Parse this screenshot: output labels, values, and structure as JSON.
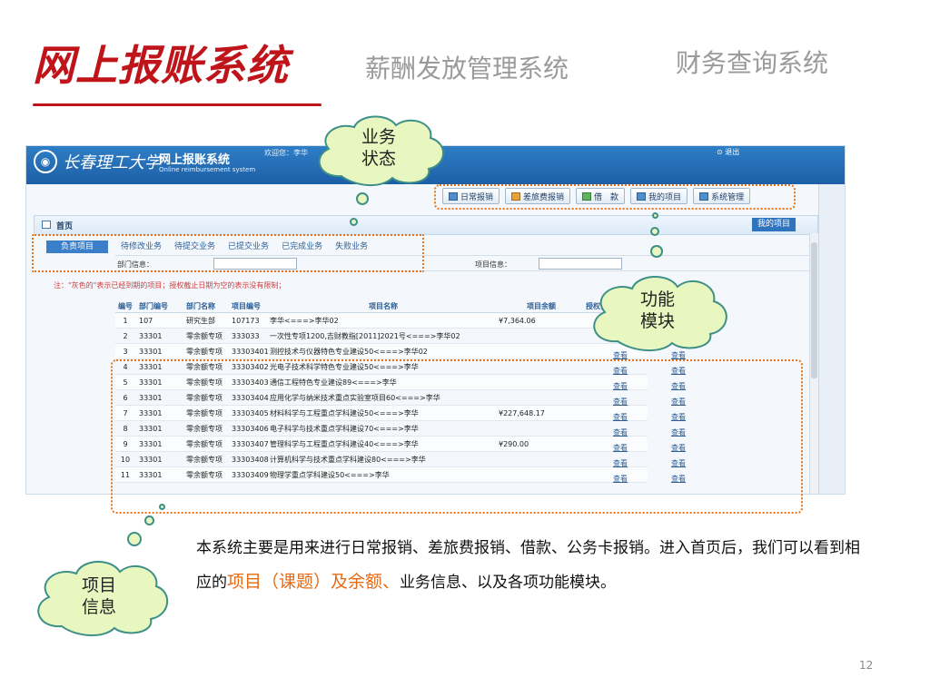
{
  "slide": {
    "title": "网上报账系统",
    "subtitle_1": "薪酬发放管理系统",
    "subtitle_2": "财务查询系统",
    "page_number": "12"
  },
  "app": {
    "university": "长春理工大学",
    "system_name": "网上报账系统",
    "system_name_en": "Online reimbursement system",
    "welcome": "欢迎您：李华",
    "exit": "退出",
    "toolbar": [
      {
        "label": "日常报销",
        "icon": "document-icon"
      },
      {
        "label": "差旅费报销",
        "icon": "car-icon"
      },
      {
        "label": "借　款",
        "icon": "money-icon"
      },
      {
        "label": "我的项目",
        "icon": "list-icon"
      },
      {
        "label": "系统管理",
        "icon": "gear-icon"
      }
    ],
    "home": "首页",
    "my_projects": "我的项目",
    "tabs": [
      "负责项目",
      "待修改业务",
      "待提交业务",
      "已提交业务",
      "已完成业务",
      "失败业务"
    ],
    "active_tab": "负责项目",
    "filter": {
      "dept_label": "部门信息：",
      "project_label": "项目信息："
    },
    "note": "注：\"灰色的\"表示已经到期的项目；授权截止日期为空的表示没有限制；",
    "table": {
      "headers": [
        "编号",
        "部门编号",
        "部门名称",
        "项目编号",
        "项目名称",
        "项目余额",
        "授权使用"
      ],
      "rows": [
        [
          "1",
          "107",
          "研究生部",
          "107173",
          "李华<===>李华02",
          "¥7,364.06",
          ""
        ],
        [
          "2",
          "33301",
          "零余额专项",
          "333033",
          "一次性专项1200,吉财教指[2011]2021号<===>李华02",
          "",
          ""
        ],
        [
          "3",
          "33301",
          "零余额专项",
          "33303401",
          "测控技术与仪器特色专业建设50<===>李华02",
          "",
          ""
        ],
        [
          "4",
          "33301",
          "零余额专项",
          "33303402",
          "光电子技术科学特色专业建设50<===>李华",
          "",
          ""
        ],
        [
          "5",
          "33301",
          "零余额专项",
          "33303403",
          "通信工程特色专业建设89<===>李华",
          "",
          ""
        ],
        [
          "6",
          "33301",
          "零余额专项",
          "33303404",
          "应用化学与纳米技术重点实验室项目60<===>李华",
          "",
          ""
        ],
        [
          "7",
          "33301",
          "零余额专项",
          "33303405",
          "材料科学与工程重点学科建设50<===>李华",
          "¥227,648.17",
          ""
        ],
        [
          "8",
          "33301",
          "零余额专项",
          "33303406",
          "电子科学与技术重点学科建设70<===>李华",
          "",
          ""
        ],
        [
          "9",
          "33301",
          "零余额专项",
          "33303407",
          "管理科学与工程重点学科建设40<===>李华",
          "¥290.00",
          ""
        ],
        [
          "10",
          "33301",
          "零余额专项",
          "33303408",
          "计算机科学与技术重点学科建设80<===>李华",
          "",
          ""
        ],
        [
          "11",
          "33301",
          "零余额专项",
          "33303409",
          "物理学重点学科建设50<===>李华",
          "",
          ""
        ]
      ],
      "action_label": "查看"
    }
  },
  "callouts": {
    "business_status": [
      "业务",
      "状态"
    ],
    "function_modules": [
      "功能",
      "模块"
    ],
    "project_info": [
      "项目",
      "信息"
    ]
  },
  "body": {
    "part1": "本系统主要是用来进行日常报销、差旅费报销、借款、公务卡报销。进入首页后，我们可以看到相应的",
    "highlight": "项目（课题）及余额、",
    "part2": "业务信息、以及各项功能模块。"
  },
  "colors": {
    "title_red": "#c0141b",
    "subtitle_gray": "#9a9a9a",
    "header_blue": "#1d5fa6",
    "callout_fill": "#e8f7c0",
    "callout_stroke": "#3d8f87",
    "dotted_frame": "#e3761d",
    "highlight_orange": "#e66a12"
  }
}
